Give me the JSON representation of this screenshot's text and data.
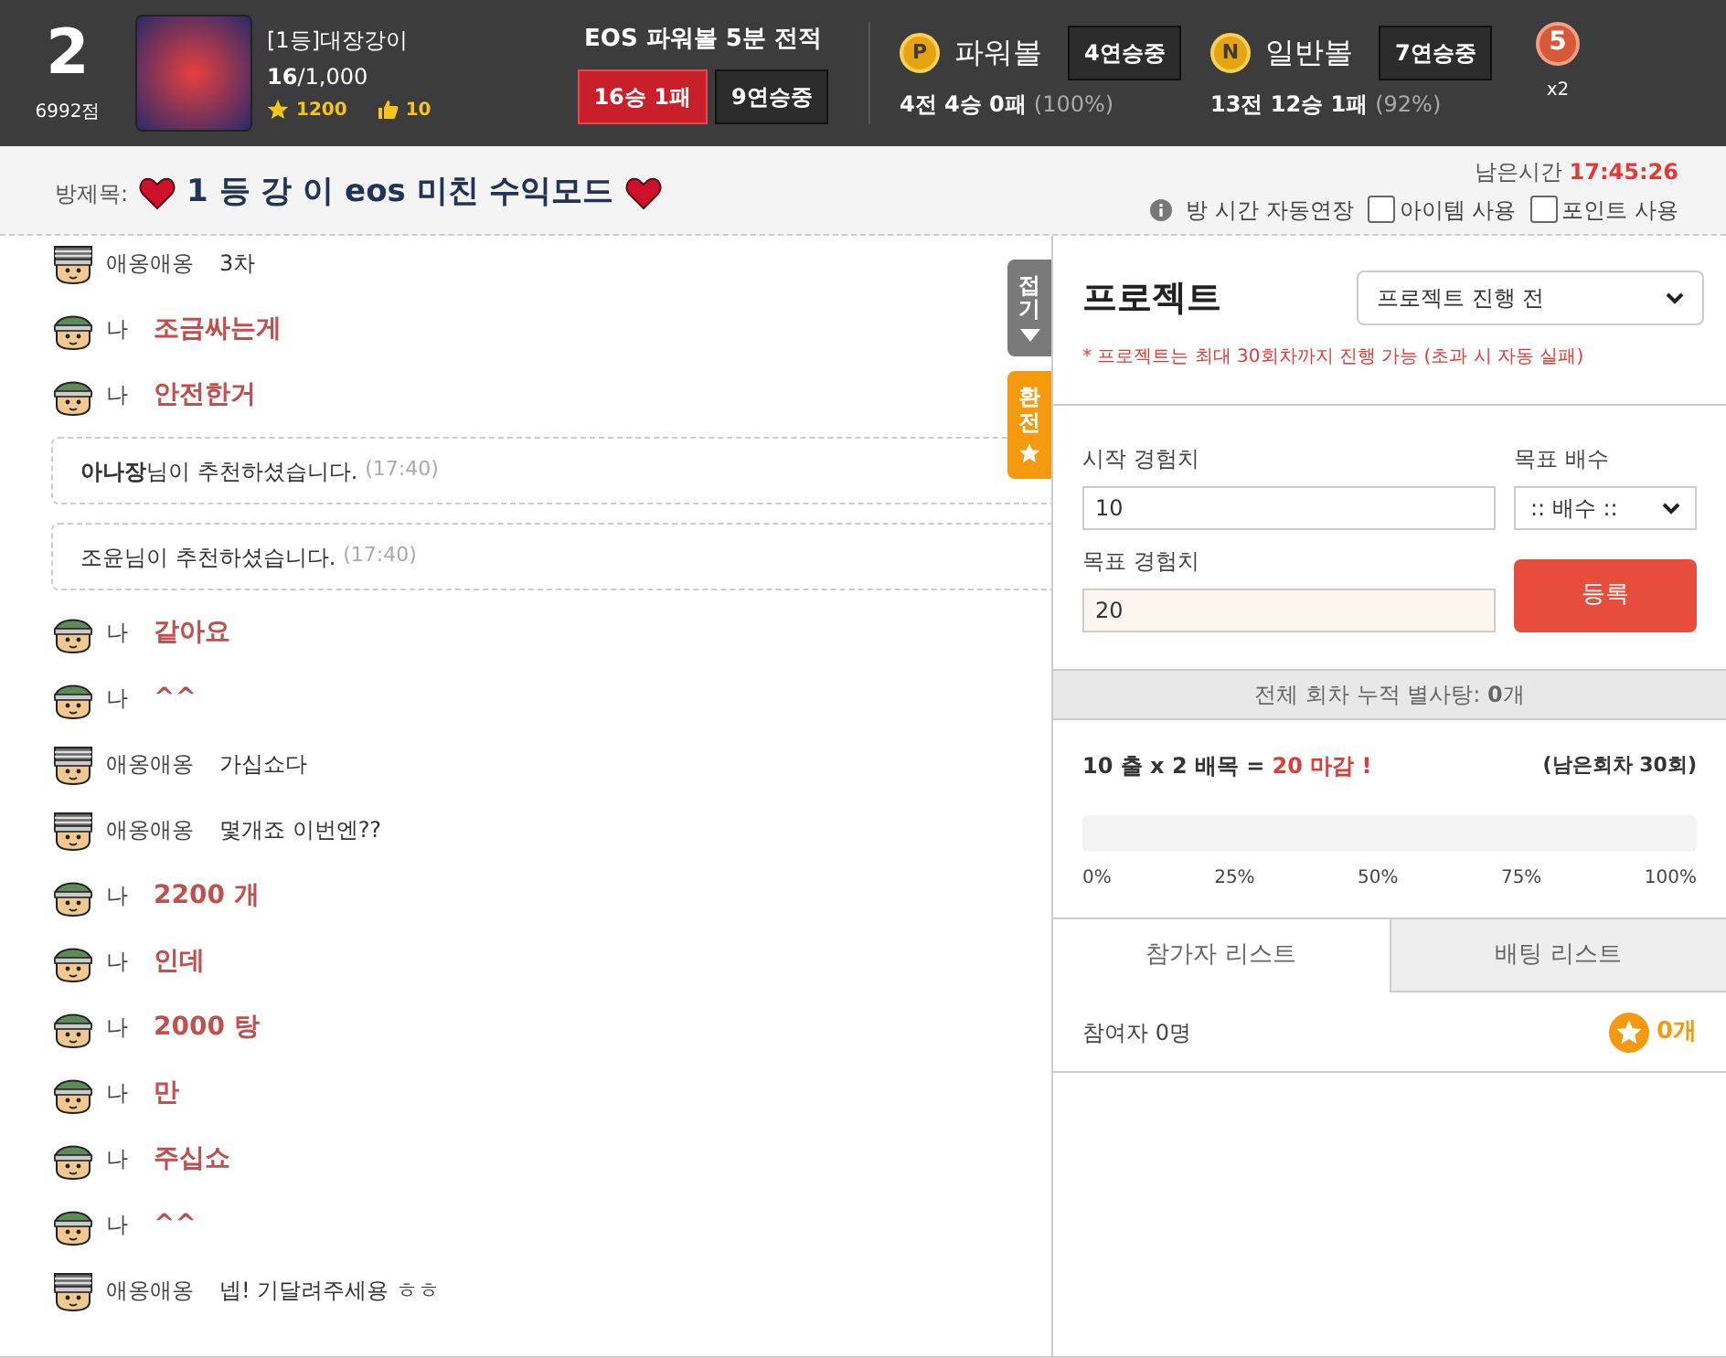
{
  "header": {
    "rank": "2",
    "points": "6992점",
    "user_name": "[1등]대장강이",
    "level": "**16**/1,000",
    "stars": "1200",
    "likes": "10",
    "record": {
      "title": "EOS 파워볼 5분 전적",
      "wins": "16승 1패",
      "streak": "9연승중"
    },
    "balls": [
      {
        "badge": "P",
        "label": "파워볼",
        "streak": "4연승중",
        "record": "4전 4승 0패",
        "rate": "(100%)"
      },
      {
        "badge": "N",
        "label": "일반볼",
        "streak": "7연승중",
        "record": "13전 12승 1패",
        "rate": "(92%)"
      }
    ],
    "medal": {
      "number": "5",
      "multiplier": "x2"
    }
  },
  "room": {
    "title_label": "방제목:",
    "title": "1 등 강 이 eos 미친 수익모드",
    "time_label": "남은시간",
    "time": "17:45:26",
    "auto_extend": "방 시간 자동연장",
    "options": [
      {
        "label": "아이템 사용",
        "checked": false
      },
      {
        "label": "포인트 사용",
        "checked": false
      }
    ]
  },
  "chat": [
    {
      "kind": "message",
      "own": false,
      "user": "애옹애옹",
      "text": "3차"
    },
    {
      "kind": "message",
      "own": true,
      "user": "나",
      "text": "조금싸는게"
    },
    {
      "kind": "message",
      "own": true,
      "user": "나",
      "text": "안전한거"
    },
    {
      "kind": "notice",
      "text": "**아나장**님이 추천하셨습니다.",
      "time": "(17:40)"
    },
    {
      "kind": "notice",
      "text": "조윤님이 추천하셨습니다.",
      "time": "(17:40)"
    },
    {
      "kind": "message",
      "own": true,
      "user": "나",
      "text": "같아요"
    },
    {
      "kind": "message",
      "own": true,
      "user": "나",
      "text": "^^"
    },
    {
      "kind": "message",
      "own": false,
      "user": "애옹애옹",
      "text": "가십쇼다"
    },
    {
      "kind": "message",
      "own": false,
      "user": "애옹애옹",
      "text": "몇개죠 이번엔??"
    },
    {
      "kind": "message",
      "own": true,
      "user": "나",
      "text": "2200 개"
    },
    {
      "kind": "message",
      "own": true,
      "user": "나",
      "text": "인데"
    },
    {
      "kind": "message",
      "own": true,
      "user": "나",
      "text": "2000 탕"
    },
    {
      "kind": "message",
      "own": true,
      "user": "나",
      "text": "만"
    },
    {
      "kind": "message",
      "own": true,
      "user": "나",
      "text": "주십쇼"
    },
    {
      "kind": "message",
      "own": true,
      "user": "나",
      "text": "^^"
    },
    {
      "kind": "message",
      "own": false,
      "user": "애옹애옹",
      "text": "넵! 기달려주세용 ㅎㅎ"
    }
  ],
  "side_tabs": [
    {
      "kind": "fold",
      "label": "접기"
    },
    {
      "kind": "exchange",
      "label": "환전"
    }
  ],
  "project": {
    "title": "프로젝트",
    "status": "프로젝트 진행 전",
    "note": "* 프로젝트는 최대 30회차까지 진행 가능 (초과 시 자동 실패)",
    "start_label": "시작 경험치",
    "start_value": "10",
    "multiplier_label": "목표 배수",
    "multiplier_value": ":: 배수 ::",
    "target_label": "목표 경험치",
    "target_value": "20",
    "submit": "등록",
    "total": "전체 회차 누적 별사탕: **0**개",
    "formula": "10 출 x 2 배목 =",
    "result": "20 마감 !",
    "remaining": "(남은회차 30회)",
    "level": 0,
    "ticks": [
      "0%",
      "25%",
      "50%",
      "75%",
      "100%"
    ],
    "tabs": [
      {
        "label": "참가자 리스트",
        "selected": true
      },
      {
        "label": "배팅 리스트",
        "selected": false
      }
    ],
    "participants": "참여자 0명",
    "candy": "0개"
  }
}
